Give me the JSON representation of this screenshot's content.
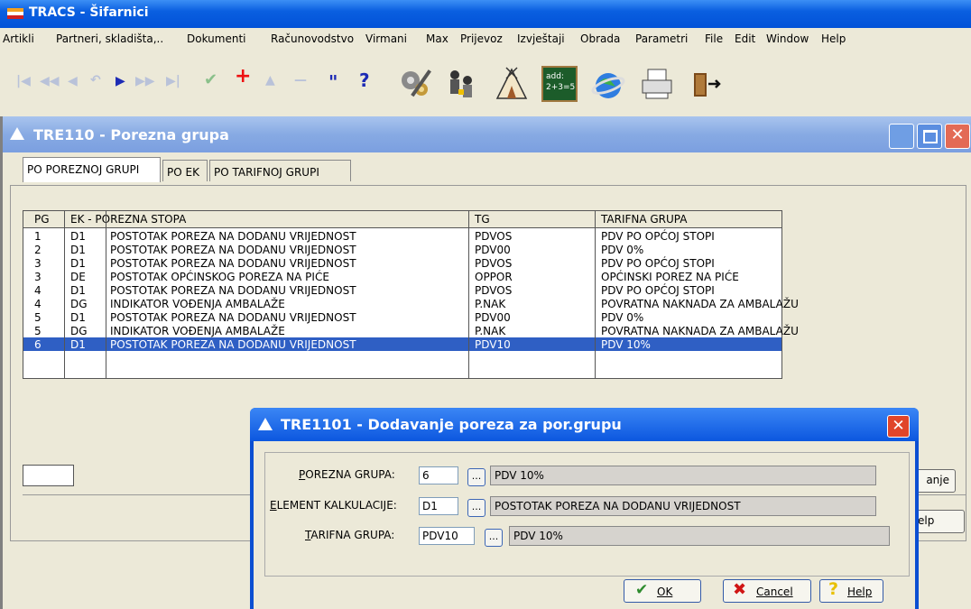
{
  "app": {
    "title": "TRACS - Šifarnici",
    "menu": [
      "Artikli",
      "Partneri, skladišta,..",
      "Dokumenti",
      "Računovodstvo",
      "Virmani",
      "Max",
      "Prijevoz",
      "Izvještaji",
      "Obrada",
      "Parametri",
      "File",
      "Edit",
      "Window",
      "Help"
    ],
    "toolbar_small": [
      "|◀",
      "◀◀",
      "◀",
      "↶",
      "▶",
      "▶▶",
      "▶|",
      "✔",
      "+",
      "▲",
      "—",
      "\"",
      "?"
    ],
    "toolbar_icons": [
      "settings-gears-icon",
      "users-icon",
      "tent-icon",
      "calculator-board-icon",
      "globe-icon",
      "printer-icon",
      "exit-door-icon"
    ],
    "calc_text": "add: 2+3=5"
  },
  "window": {
    "title": "TRE110 - Porezna grupa",
    "tabs": [
      "PO POREZNOJ GRUPI",
      "PO EK",
      "PO TARIFNOJ GRUPI"
    ],
    "grid": {
      "headers": [
        "PG",
        "EK - POREZNA STOPA",
        "TG",
        "TARIFNA GRUPA"
      ],
      "rows": [
        {
          "pg": "1",
          "ek": "D1",
          "stopa": "POSTOTAK POREZA NA DODANU VRIJEDNOST",
          "tg": "PDVOS",
          "tarifa": "PDV PO OPĆOJ STOPI"
        },
        {
          "pg": "2",
          "ek": "D1",
          "stopa": "POSTOTAK POREZA NA DODANU VRIJEDNOST",
          "tg": "PDV00",
          "tarifa": "PDV 0%"
        },
        {
          "pg": "3",
          "ek": "D1",
          "stopa": "POSTOTAK POREZA NA DODANU VRIJEDNOST",
          "tg": "PDVOS",
          "tarifa": "PDV PO OPĆOJ STOPI"
        },
        {
          "pg": "3",
          "ek": "DE",
          "stopa": "POSTOTAK OPĆINSKOG POREZA NA PIĆE",
          "tg": "OPPOR",
          "tarifa": "OPĆINSKI POREZ NA PIĆE"
        },
        {
          "pg": "4",
          "ek": "D1",
          "stopa": "POSTOTAK POREZA NA DODANU VRIJEDNOST",
          "tg": "PDVOS",
          "tarifa": "PDV PO OPĆOJ STOPI"
        },
        {
          "pg": "4",
          "ek": "DG",
          "stopa": "INDIKATOR VOĐENJA AMBALAŽE",
          "tg": "P.NAK",
          "tarifa": "POVRATNA NAKNADA ZA AMBALAŽU"
        },
        {
          "pg": "5",
          "ek": "D1",
          "stopa": "POSTOTAK POREZA NA DODANU VRIJEDNOST",
          "tg": "PDV00",
          "tarifa": "PDV 0%"
        },
        {
          "pg": "5",
          "ek": "DG",
          "stopa": "INDIKATOR VOĐENJA AMBALAŽE",
          "tg": "P.NAK",
          "tarifa": "POVRATNA NAKNADA ZA AMBALAŽU"
        },
        {
          "pg": "6",
          "ek": "D1",
          "stopa": "POSTOTAK POREZA NA DODANU VRIJEDNOST",
          "tg": "PDV10",
          "tarifa": "PDV 10%"
        }
      ]
    },
    "side_buttons": [
      "anje",
      "elp"
    ]
  },
  "dialog": {
    "title": "TRE1101 - Dodavanje poreza za por.grupu",
    "fields": [
      {
        "label_u": "P",
        "label_rest": "OREZNA GRUPA:",
        "value": "6",
        "browse": "...",
        "desc": "PDV 10%"
      },
      {
        "label_u": "E",
        "label_rest": "LEMENT KALKULACIJE:",
        "value": "D1",
        "browse": "...",
        "desc": "POSTOTAK POREZA NA DODANU VRIJEDNOST"
      },
      {
        "label_u": "T",
        "label_rest": "ARIFNA GRUPA:",
        "value": "PDV10",
        "browse": "...",
        "desc": "PDV 10%"
      }
    ],
    "buttons": {
      "ok": "OK",
      "cancel": "Cancel",
      "help": "Help"
    }
  },
  "colors": {
    "selection": "#2f5fc4",
    "titlebar": "#0252d8",
    "window_bg": "#ece9d8"
  }
}
